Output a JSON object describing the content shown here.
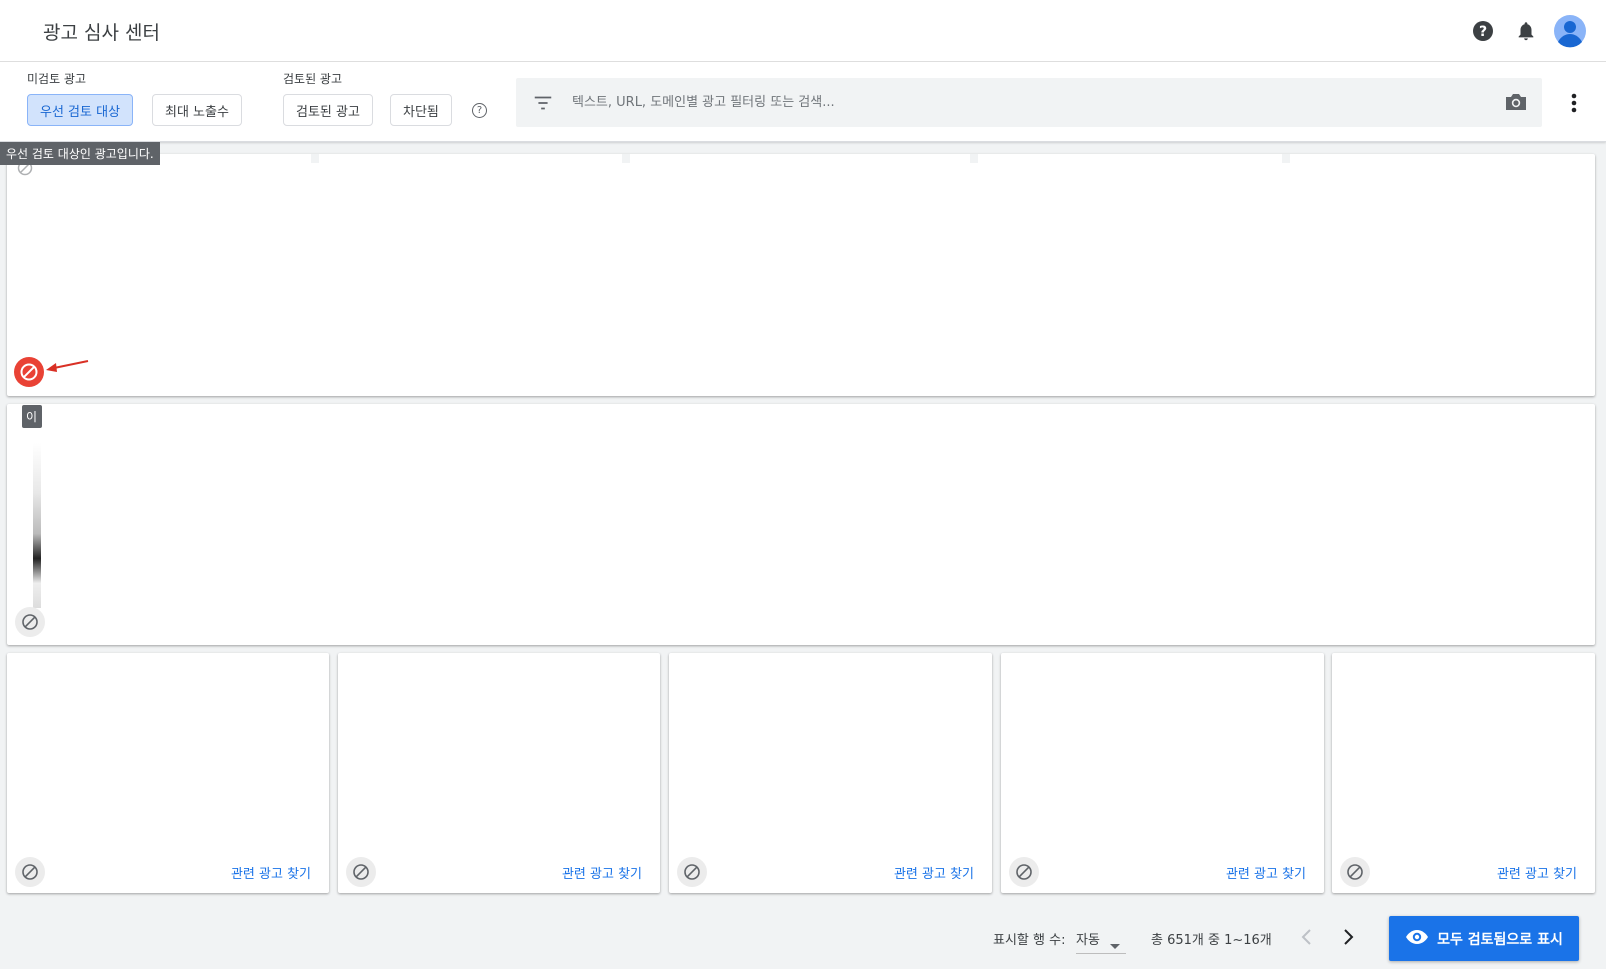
{
  "header": {
    "title": "광고 심사 센터",
    "icons": [
      "help-icon",
      "notifications-icon",
      "account-avatar"
    ]
  },
  "filters": {
    "unreviewed_label": "미검토 광고",
    "unreviewed_chips": [
      "우선 검토 대상",
      "최대 노출수"
    ],
    "reviewed_label": "검토된 광고",
    "reviewed_chips": [
      "검토된 광고",
      "차단됨"
    ],
    "help_glyph": "?",
    "search_placeholder": "텍스트, URL, 도메인별 광고 필터링 또는 검색..."
  },
  "tooltips": {
    "priority": "우선 검토 대상인 광고입니다.",
    "partial": "이"
  },
  "cards": {
    "related_label": "관련 광고 찾기"
  },
  "footer": {
    "rows_label": "표시할 행 수:",
    "rows_value": "자동",
    "range_text": "총 651개 중 1~16개",
    "mark_all_button": "모두 검토됨으로 표시"
  },
  "colors": {
    "accent": "#1a73e8",
    "block_active": "#e94235",
    "chip_active_bg": "#d2e3fc",
    "annotation_arrow": "#d93025"
  }
}
